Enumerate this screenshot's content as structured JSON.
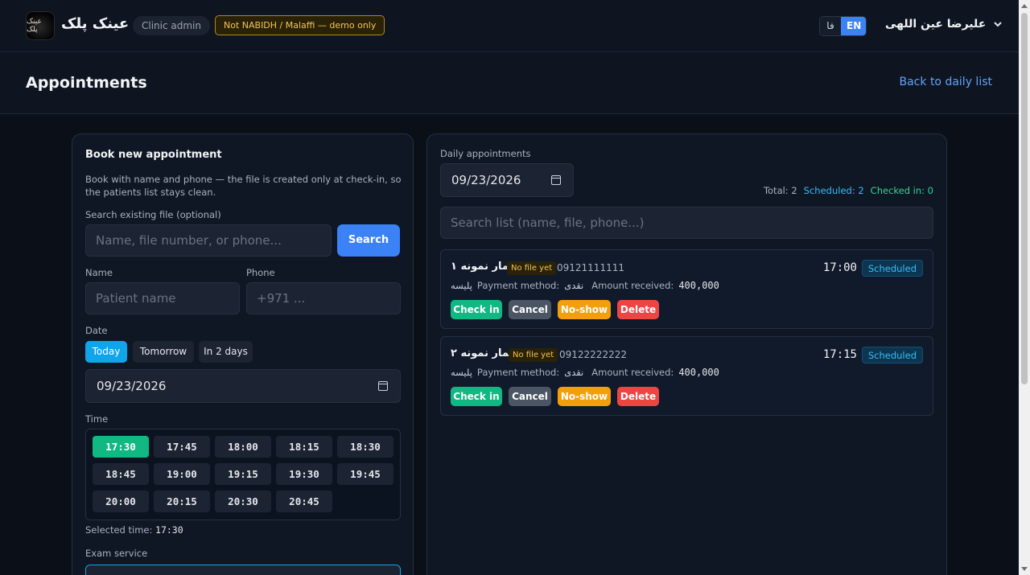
{
  "header": {
    "logo_text": "عینک پلک",
    "brand": "عینک پلک",
    "role": "Clinic admin",
    "warning": "Not NABIDH / Malaffi — demo only",
    "lang_fa": "فا",
    "lang_en": "EN",
    "user_name": "علیرضا عین اللهی"
  },
  "page": {
    "title": "Appointments",
    "back_link": "Back to daily list"
  },
  "booking": {
    "title": "Book new appointment",
    "description": "Book with name and phone — the file is created only at check-in, so the patients list stays clean.",
    "search_label": "Search existing file (optional)",
    "search_placeholder": "Name, file number, or phone...",
    "search_button": "Search",
    "name_label": "Name",
    "name_placeholder": "Patient name",
    "phone_label": "Phone",
    "phone_placeholder": "+971 ...",
    "date_label": "Date",
    "quick_dates": [
      "Today",
      "Tomorrow",
      "In 2 days"
    ],
    "date_value": "09/23/2026",
    "time_label": "Time",
    "time_slots": [
      "17:30",
      "17:45",
      "18:00",
      "18:15",
      "18:30",
      "18:45",
      "19:00",
      "19:15",
      "19:30",
      "19:45",
      "20:00",
      "20:15",
      "20:30",
      "20:45"
    ],
    "selected_time_label": "Selected time:",
    "selected_time": "17:30",
    "service_label": "Exam service"
  },
  "daily": {
    "label": "Daily appointments",
    "date_value": "09/23/2026",
    "stats": {
      "total": "Total: 2",
      "scheduled": "Scheduled: 2",
      "checked_in": "Checked in: 0"
    },
    "search_placeholder": "Search list (name, file, phone...)",
    "appointments": [
      {
        "name": "بیمار نمونه ۱",
        "file_badge": "No file yet",
        "phone": "09121111111",
        "time": "17:00",
        "status": "Scheduled",
        "insurance": "پلیسه",
        "payment_label": "Payment method:",
        "payment_value": "نقدی",
        "amount_label": "Amount received:",
        "amount_value": "400,000"
      },
      {
        "name": "بیمار نمونه ۲",
        "file_badge": "No file yet",
        "phone": "09122222222",
        "time": "17:15",
        "status": "Scheduled",
        "insurance": "پلیسه",
        "payment_label": "Payment method:",
        "payment_value": "نقدی",
        "amount_label": "Amount received:",
        "amount_value": "400,000"
      }
    ],
    "actions": {
      "check_in": "Check in",
      "cancel": "Cancel",
      "no_show": "No-show",
      "delete": "Delete"
    }
  },
  "colors": {
    "accent": "#3b82f6",
    "success": "#10b981",
    "warning": "#f59e0b",
    "danger": "#ef4444",
    "info": "#0ea5e9"
  }
}
